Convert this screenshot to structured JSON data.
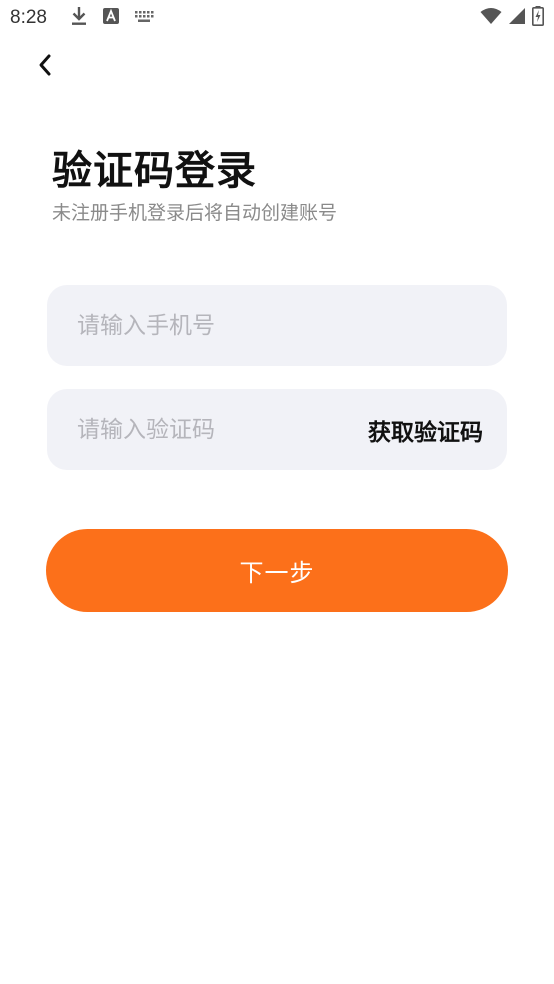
{
  "status_bar": {
    "time": "8:28",
    "left_icons": [
      "download-icon",
      "a-letter-icon",
      "keyboard-icon"
    ],
    "right_icons": [
      "wifi-icon",
      "signal-icon",
      "battery-charging-icon"
    ]
  },
  "header": {
    "back_icon": "chevron-left-icon"
  },
  "login": {
    "title": "验证码登录",
    "subtitle": "未注册手机登录后将自动创建账号",
    "phone_placeholder": "请输入手机号",
    "phone_value": "",
    "code_placeholder": "请输入验证码",
    "code_value": "",
    "get_code_label": "获取验证码",
    "next_label": "下一步"
  },
  "colors": {
    "accent": "#fc701a",
    "field_bg": "#f1f2f7",
    "placeholder": "#b5b5bb",
    "subtitle": "#8a8a8a",
    "title": "#111111"
  }
}
